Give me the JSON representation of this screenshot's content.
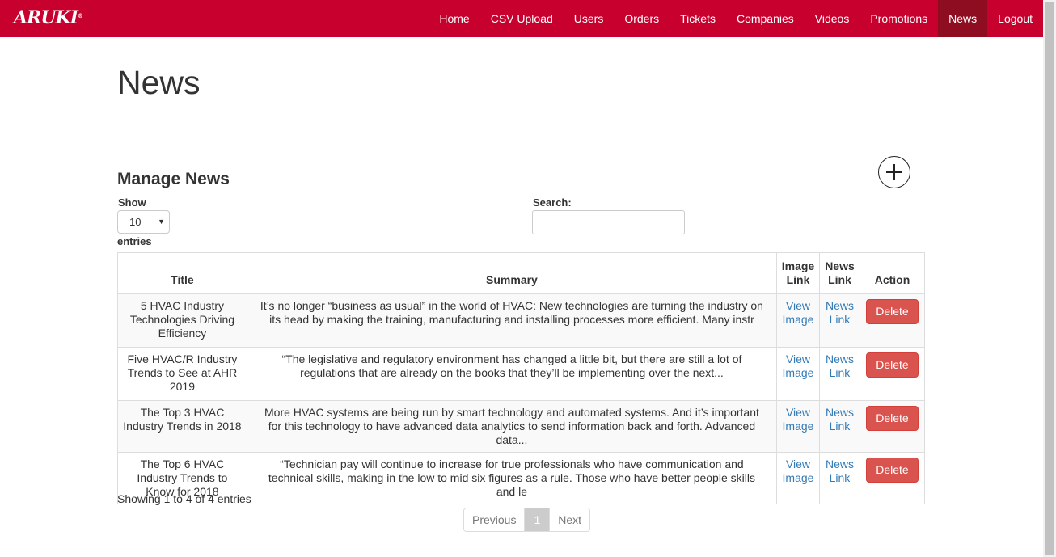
{
  "brand": {
    "logo_text": "ARUKI",
    "registered": "®"
  },
  "nav": {
    "items": [
      {
        "label": "Home"
      },
      {
        "label": "CSV Upload"
      },
      {
        "label": "Users"
      },
      {
        "label": "Orders"
      },
      {
        "label": "Tickets"
      },
      {
        "label": "Companies"
      },
      {
        "label": "Videos"
      },
      {
        "label": "Promotions"
      },
      {
        "label": "News",
        "active": true
      },
      {
        "label": "Logout"
      }
    ]
  },
  "page": {
    "title": "News"
  },
  "manage": {
    "title": "Manage News",
    "add_icon": "plus-circle-icon",
    "show_label": "Show",
    "entries_label": "entries",
    "page_length": "10",
    "search_label": "Search:",
    "search_value": ""
  },
  "table": {
    "columns": {
      "title": "Title",
      "summary": "Summary",
      "image_link": "Image Link",
      "news_link": "News Link",
      "action": "Action"
    },
    "rows": [
      {
        "title": "5 HVAC Industry Technologies Driving Efficiency",
        "summary": "It’s no longer “business as usual” in the world of HVAC: New technologies are turning the industry on its head by making the training, manufacturing and installing processes more efficient. Many instr",
        "image_link": "View Image",
        "news_link": "News Link",
        "action": "Delete"
      },
      {
        "title": "Five HVAC/R Industry Trends to See at AHR 2019",
        "summary": "“The legislative and regulatory environment has changed a little bit, but there are still a lot of regulations that are already on the books that they’ll be implementing over the next...",
        "image_link": "View Image",
        "news_link": "News Link",
        "action": "Delete"
      },
      {
        "title": "The Top 3 HVAC Industry Trends in 2018",
        "summary": "More HVAC systems are being run by smart technology and automated systems. And it’s important for this technology to have advanced data analytics to send information back and forth. Advanced data...",
        "image_link": "View Image",
        "news_link": "News Link",
        "action": "Delete"
      },
      {
        "title": "The Top 6 HVAC Industry Trends to Know for 2018",
        "summary": "“Technician pay will continue to increase for true professionals who have communication and technical skills, making in the low to mid six figures as a rule. Those who have better people skills and le",
        "image_link": "View Image",
        "news_link": "News Link",
        "action": "Delete"
      }
    ]
  },
  "footer": {
    "info": "Showing 1 to 4 of 4 entries",
    "previous": "Previous",
    "current_page": "1",
    "next": "Next"
  },
  "colors": {
    "navbar": "#c8002d",
    "nav_active": "#8f0d20",
    "delete": "#d9534f",
    "link": "#337ab7"
  }
}
